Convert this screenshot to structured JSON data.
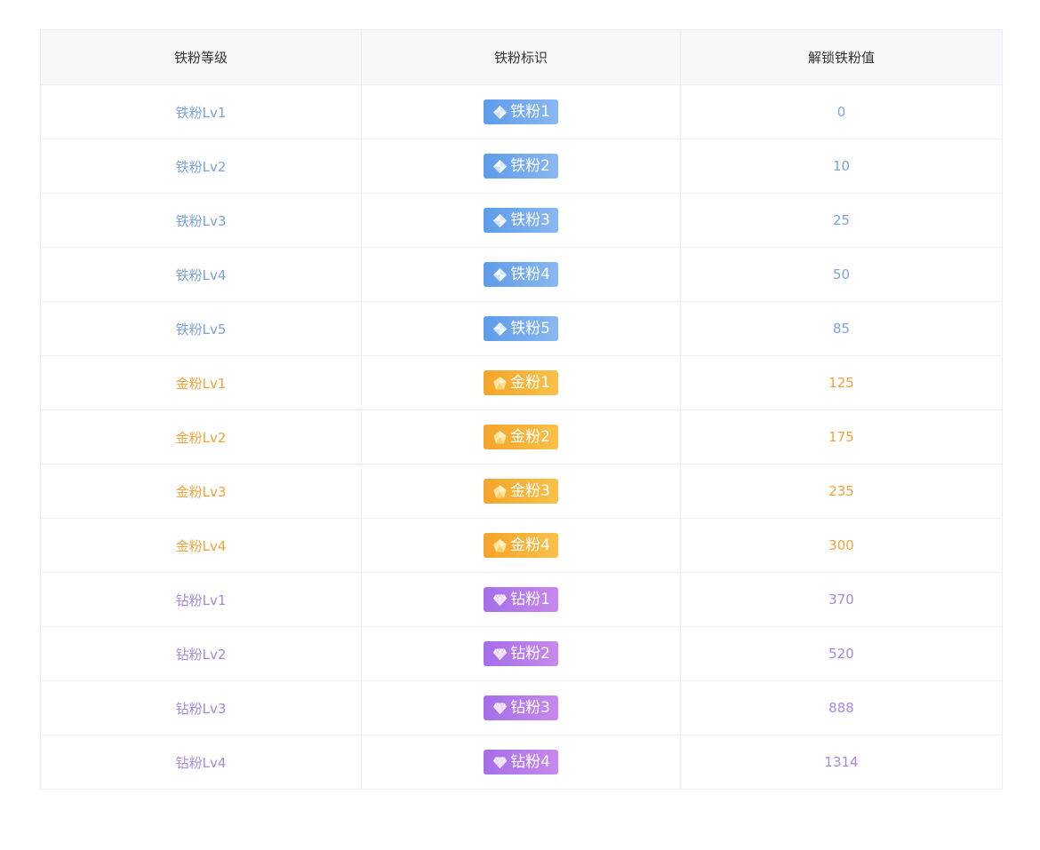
{
  "colors": {
    "iron": "#7aa3e0",
    "gold": "#f2a23b",
    "diamond": "#a788df"
  },
  "table": {
    "headers": [
      "铁粉等级",
      "铁粉标识",
      "解锁铁粉值"
    ],
    "rows": [
      {
        "level": "铁粉Lv1",
        "badge": "铁粉1",
        "value": "0",
        "tier": "iron",
        "icon": "iron-diamond-icon"
      },
      {
        "level": "铁粉Lv2",
        "badge": "铁粉2",
        "value": "10",
        "tier": "iron",
        "icon": "iron-diamond-icon"
      },
      {
        "level": "铁粉Lv3",
        "badge": "铁粉3",
        "value": "25",
        "tier": "iron",
        "icon": "iron-diamond-icon"
      },
      {
        "level": "铁粉Lv4",
        "badge": "铁粉4",
        "value": "50",
        "tier": "iron",
        "icon": "iron-diamond-icon"
      },
      {
        "level": "铁粉Lv5",
        "badge": "铁粉5",
        "value": "85",
        "tier": "iron",
        "icon": "iron-diamond-icon"
      },
      {
        "level": "金粉Lv1",
        "badge": "金粉1",
        "value": "125",
        "tier": "gold",
        "icon": "gold-pentagon-icon"
      },
      {
        "level": "金粉Lv2",
        "badge": "金粉2",
        "value": "175",
        "tier": "gold",
        "icon": "gold-pentagon-icon"
      },
      {
        "level": "金粉Lv3",
        "badge": "金粉3",
        "value": "235",
        "tier": "gold",
        "icon": "gold-pentagon-icon"
      },
      {
        "level": "金粉Lv4",
        "badge": "金粉4",
        "value": "300",
        "tier": "gold",
        "icon": "gold-pentagon-icon"
      },
      {
        "level": "钻粉Lv1",
        "badge": "钻粉1",
        "value": "370",
        "tier": "diamond",
        "icon": "gem-icon"
      },
      {
        "level": "钻粉Lv2",
        "badge": "钻粉2",
        "value": "520",
        "tier": "diamond",
        "icon": "gem-icon"
      },
      {
        "level": "钻粉Lv3",
        "badge": "钻粉3",
        "value": "888",
        "tier": "diamond",
        "icon": "gem-icon"
      },
      {
        "level": "钻粉Lv4",
        "badge": "钻粉4",
        "value": "1314",
        "tier": "diamond",
        "icon": "gem-icon"
      }
    ]
  }
}
